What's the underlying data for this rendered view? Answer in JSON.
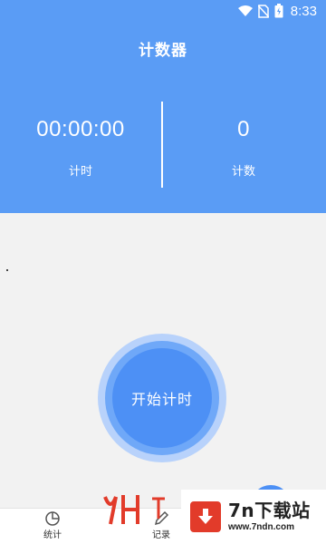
{
  "status_bar": {
    "time": "8:33",
    "icons": [
      "wifi-icon",
      "no-sim-icon",
      "battery-icon"
    ]
  },
  "header": {
    "title": "计数器"
  },
  "timer": {
    "value": "00:00:00",
    "label": "计时"
  },
  "counter": {
    "value": "0",
    "label": "计数"
  },
  "start_button": {
    "label": "开始计时"
  },
  "bottom_nav": {
    "items": [
      {
        "label": "统计",
        "icon": "pie-chart-icon"
      },
      {
        "label": "记录",
        "icon": "pen-icon"
      }
    ]
  },
  "watermark": {
    "title": "7n下载站",
    "url": "www.7ndn.com"
  },
  "colors": {
    "header_bg": "#5a9cf5",
    "button_inner": "#4d90f5",
    "button_ring": "#b8d2fb",
    "background": "#f2f2f2"
  }
}
